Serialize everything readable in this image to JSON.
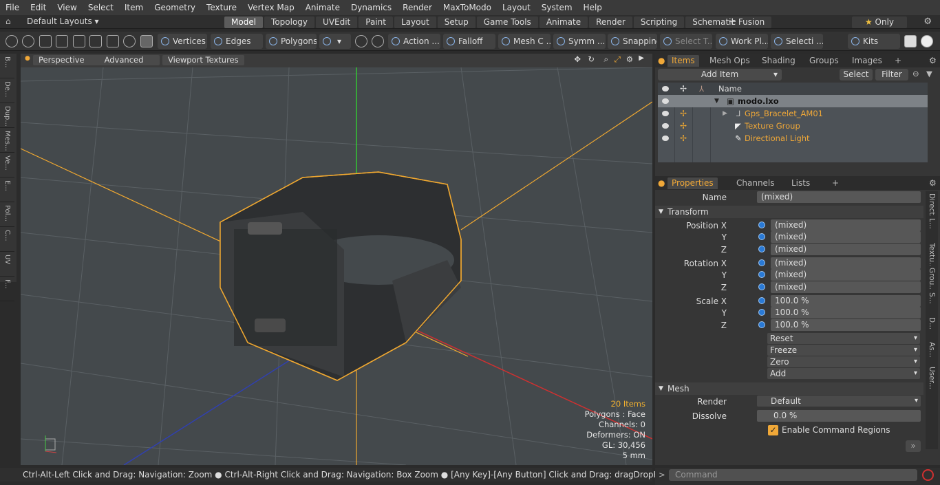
{
  "menu": [
    "File",
    "Edit",
    "View",
    "Select",
    "Item",
    "Geometry",
    "Texture",
    "Vertex Map",
    "Animate",
    "Dynamics",
    "Render",
    "MaxToModo",
    "Layout",
    "System",
    "Help"
  ],
  "layout_selector": "Default Layouts",
  "mode_tabs": [
    "Model",
    "Topology",
    "UVEdit",
    "Paint",
    "Layout",
    "Setup",
    "Game Tools",
    "Animate",
    "Render",
    "Scripting",
    "Schematic Fusion"
  ],
  "active_tab": "Model",
  "only_label": "Only",
  "toolbar": {
    "vertices": "Vertices",
    "edges": "Edges",
    "polygons": "Polygons",
    "action": "Action ...",
    "falloff": "Falloff",
    "mesh": "Mesh C ...",
    "symmetry": "Symm ...",
    "snapping": "Snapping",
    "select_t": "Select T...",
    "workplane": "Work Pl...",
    "selection": "Selecti ...",
    "kits": "Kits"
  },
  "left_strip": [
    "B...",
    "De...",
    "Dup...",
    "Mes...",
    "Ve...",
    "E...",
    "Pol...",
    "C...",
    "UV",
    "F..."
  ],
  "viewport": {
    "perspective": "Perspective",
    "advanced": "Advanced",
    "textures": "Viewport Textures",
    "info": {
      "items": "20 Items",
      "polygons": "Polygons : Face",
      "channels": "Channels: 0",
      "deformers": "Deformers: ON",
      "gl": "GL: 30,456",
      "scale": "5 mm"
    }
  },
  "items_panel": {
    "tabs": [
      "Items",
      "Mesh Ops",
      "Shading",
      "Groups",
      "Images"
    ],
    "active": "Items",
    "add_item": "Add Item",
    "select": "Select",
    "filter": "Filter",
    "name_header": "Name",
    "rows": [
      {
        "name": "modo.lxo"
      },
      {
        "name": "Gps_Bracelet_AM01"
      },
      {
        "name": "Texture Group"
      },
      {
        "name": "Directional Light"
      }
    ]
  },
  "properties": {
    "tabs": [
      "Properties",
      "Channels",
      "Lists"
    ],
    "active": "Properties",
    "name_label": "Name",
    "name_value": "(mixed)",
    "transform": "Transform",
    "position_x": "Position X",
    "rotation_x": "Rotation X",
    "scale_x": "Scale X",
    "y": "Y",
    "z": "Z",
    "mixed": "(mixed)",
    "scale_val": "100.0 %",
    "reset": "Reset",
    "freeze": "Freeze",
    "zero": "Zero",
    "add": "Add",
    "mesh": "Mesh",
    "render_label": "Render",
    "render_value": "Default",
    "dissolve_label": "Dissolve",
    "dissolve_value": "0.0 %",
    "enable_cmd": "Enable Command Regions"
  },
  "side_tabs": [
    "Direct...",
    "L...",
    "Textu...",
    "Grou...",
    "S...",
    "D...",
    "As...",
    "User..."
  ],
  "status": "Ctrl-Alt-Left Click and Drag: Navigation: Zoom ● Ctrl-Alt-Right Click and Drag: Navigation: Box Zoom ● [Any Key]-[Any Button] Click and Drag: dragDropBegin",
  "command_placeholder": "Command",
  "colors": {
    "accent": "#f0a838",
    "selected_orange": "#f0a830",
    "axis_green": "#33c533",
    "axis_red": "#d03030",
    "axis_blue": "#3040b0"
  }
}
